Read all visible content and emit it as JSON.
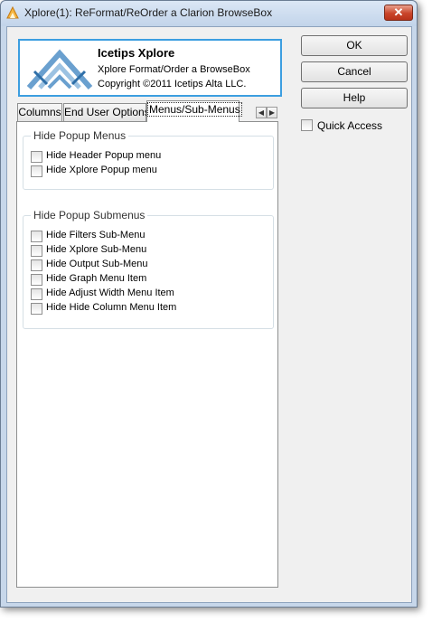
{
  "window": {
    "title": "Xplore(1): ReFormat/ReOrder a Clarion BrowseBox",
    "close_glyph": "✕",
    "icon": "xplore-app-icon"
  },
  "header": {
    "title": "Icetips Xplore",
    "subtitle": "Xplore Format/Order a BrowseBox",
    "copyright": "Copyright ©2011 Icetips Alta LLC.",
    "logo": "icetips-logo-icon"
  },
  "buttons": {
    "ok": "OK",
    "cancel": "Cancel",
    "help": "Help"
  },
  "quick_access": {
    "label": "Quick Access",
    "checked": false
  },
  "tabs": [
    {
      "label": "Columns",
      "active": false
    },
    {
      "label": "End User Options",
      "active": false
    },
    {
      "label": "Menus/Sub-Menus",
      "active": true
    }
  ],
  "tab_scroll": {
    "left": "◀",
    "right": "▶"
  },
  "groups": {
    "popup_menus": {
      "legend": "Hide Popup Menus",
      "items": [
        {
          "label": "Hide Header Popup menu",
          "checked": false
        },
        {
          "label": "Hide Xplore Popup menu",
          "checked": false
        }
      ]
    },
    "popup_submenus": {
      "legend": "Hide Popup Submenus",
      "items": [
        {
          "label": "Hide Filters Sub-Menu",
          "checked": false
        },
        {
          "label": "Hide Xplore Sub-Menu",
          "checked": false
        },
        {
          "label": "Hide Output Sub-Menu",
          "checked": false
        },
        {
          "label": "Hide Graph Menu Item",
          "checked": false
        },
        {
          "label": "Hide Adjust Width Menu Item",
          "checked": false
        },
        {
          "label": "Hide Hide Column Menu Item",
          "checked": false
        }
      ]
    }
  },
  "colors": {
    "accent_border": "#3c9ee0",
    "close_red": "#c9452a",
    "logo_blue": "#6aa0cf"
  }
}
